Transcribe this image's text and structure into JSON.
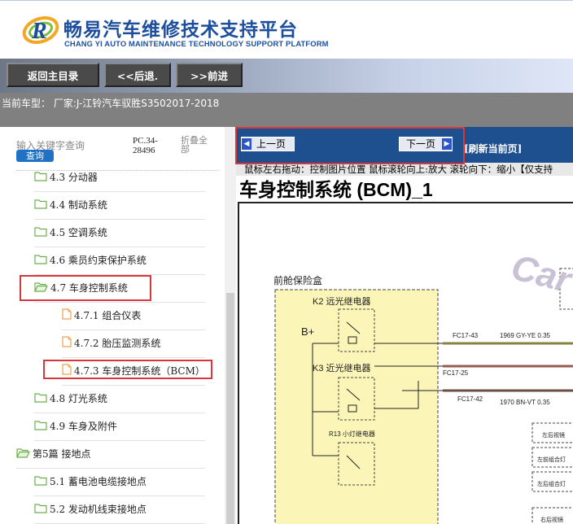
{
  "header": {
    "brand_cn": "畅易汽车维修技术支持平台",
    "brand_en": "CHANG YI AUTO MAINTENANCE TECHNOLOGY SUPPORT PLATFORM",
    "brand_color": "#1d4e9e"
  },
  "nav": {
    "home": "返回主目录",
    "back": "<<后退.",
    "forward": ">>前进"
  },
  "cartype": {
    "text": "当前车型：   厂家:J-江铃汽车驭胜S3502017-2018"
  },
  "left": {
    "search_hint": "输入关键字查询",
    "search_button": "查询",
    "pc_code": "PC.34-28496",
    "fold_all": "折叠全部",
    "tree": [
      {
        "label": "4.3 分动器",
        "icon": "folder-icon"
      },
      {
        "label": "4.4 制动系统",
        "icon": "folder-icon"
      },
      {
        "label": "4.5 空调系统",
        "icon": "folder-icon"
      },
      {
        "label": "4.6 乘员约束保护系统",
        "icon": "folder-icon"
      },
      {
        "label": "4.7 车身控制系统",
        "icon": "folder-open-icon"
      },
      {
        "label": "4.7.1 组合仪表",
        "icon": "document-icon"
      },
      {
        "label": "4.7.2 胎压监测系统",
        "icon": "document-icon"
      },
      {
        "label": "4.7.3 车身控制系统（BCM）",
        "icon": "document-icon"
      },
      {
        "label": "4.8 灯光系统",
        "icon": "folder-icon"
      },
      {
        "label": "4.9 车身及附件",
        "icon": "folder-icon"
      },
      {
        "label": "第5篇 接地点",
        "icon": "folder-open-icon"
      },
      {
        "label": "5.1 蓄电池电缆接地点",
        "icon": "folder-icon"
      },
      {
        "label": "5.2 发动机线束接地点",
        "icon": "folder-icon"
      }
    ]
  },
  "right": {
    "prev_page": "上一页",
    "next_page": "下一页",
    "refresh": "[刷新当前页]",
    "hint": "鼠标左右拖动：控制图片位置  鼠标滚轮向上:放大   滚轮向下：缩小【仅支持",
    "diagram_title": "车身控制系统 (BCM)_1",
    "diagram": {
      "fusebox_label": "前舱保险盒",
      "k2": "K2 远光继电器",
      "k3": "K3 近光继电器",
      "r13": "R13 小灯继电器",
      "bplus": "B+",
      "w1_conn": "FC17-43",
      "w1_label": "1969 GY-YE 0.35",
      "w2_conn": "FC17-25",
      "w3_conn": "FC17-42",
      "w3_label": "1970 BN-VT 0.35",
      "right_box_1": "左后视镜",
      "right_box_2": "左前组合灯",
      "right_box_3": "左后组合灯",
      "right_box_4": "右后视镜",
      "watermark": "Car"
    }
  }
}
